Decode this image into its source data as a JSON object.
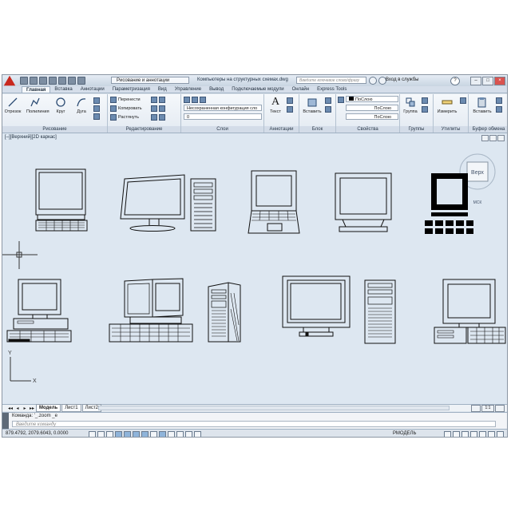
{
  "app": {
    "workspace": "Рисование и аннотации",
    "document_title": "Компьютеры на структурных схемах.dwg",
    "search_placeholder": "Введите ключевое слово/фразу",
    "sign_in": "Вход в службы",
    "help": "?"
  },
  "ribbon": {
    "tabs": [
      "Главная",
      "Вставка",
      "Аннотации",
      "Параметризация",
      "Вид",
      "Управление",
      "Вывод",
      "Подключаемые модули",
      "Онлайн",
      "Express Tools"
    ],
    "active_tab": 0,
    "draw": {
      "title": "Рисование",
      "line": "Отрезок",
      "polyline": "Полилиния",
      "circle": "Круг",
      "arc": "Дуга"
    },
    "modify": {
      "title": "Редактирование",
      "move": "Перенести",
      "copy": "Копировать",
      "stretch": "Растянуть"
    },
    "layers": {
      "title": "Слои",
      "state": "Несохраненная конфигурация сло",
      "current": "0"
    },
    "annotation": {
      "title": "Аннотации",
      "text": "Текст"
    },
    "block": {
      "title": "Блок",
      "insert": "Вставить"
    },
    "properties": {
      "title": "Свойства",
      "color": "ПоСлою",
      "linetype": "ПоСлою",
      "lineweight": "ПоСлою"
    },
    "groups": {
      "title": "Группы",
      "group": "Группа"
    },
    "utilities": {
      "title": "Утилиты",
      "measure": "Измерить"
    },
    "clipboard": {
      "title": "Буфер обмена",
      "paste": "Вставить"
    }
  },
  "viewport": {
    "label": "[–][Верхний][2D каркас]",
    "viewcube": "Верх",
    "wcs": "МСК",
    "ucs_x": "X",
    "ucs_y": "Y"
  },
  "layout_tabs": [
    "Модель",
    "Лист1",
    "Лист2"
  ],
  "active_layout": 0,
  "command": {
    "history": "Команда: '_.zoom _e",
    "placeholder": "Введите команду"
  },
  "status": {
    "coords": "879.4792, 2079.6043, 0.0000",
    "model": "РМОДЕЛЬ",
    "scale": "1:1"
  },
  "colors": {
    "background": "#dde7f1",
    "ribbon": "#e9eff5",
    "accent": "#c8281e",
    "stroke": "#111111"
  }
}
